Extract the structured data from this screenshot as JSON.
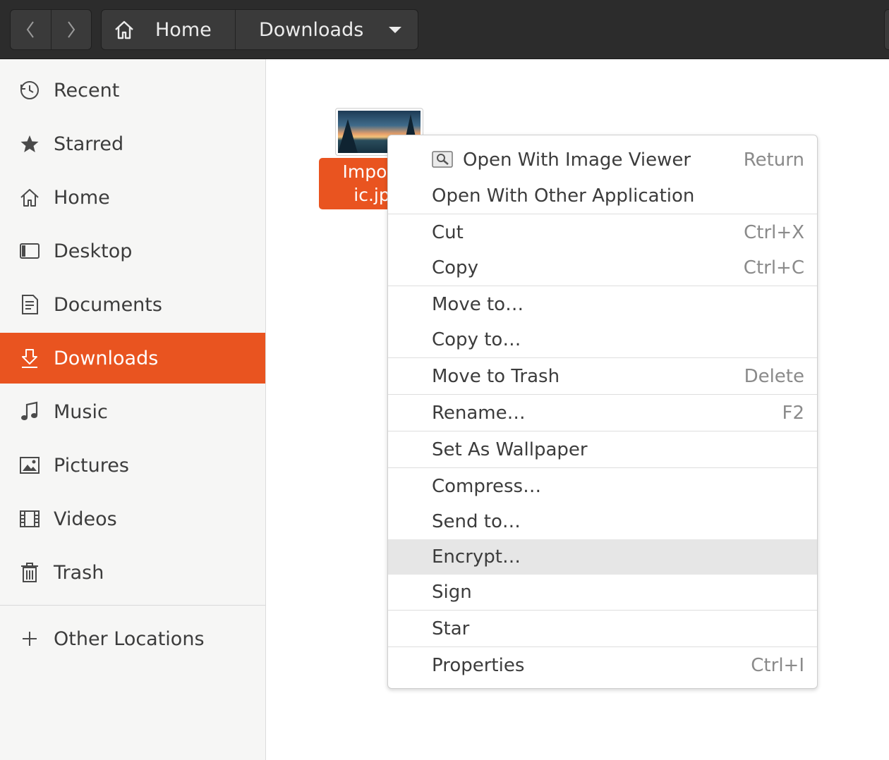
{
  "header": {
    "path": [
      {
        "label": "Home",
        "icon": "home-icon"
      },
      {
        "label": "Downloads",
        "icon": "chevron-down-icon"
      }
    ]
  },
  "sidebar": {
    "items": [
      {
        "label": "Recent",
        "icon": "clock-icon"
      },
      {
        "label": "Starred",
        "icon": "star-icon"
      },
      {
        "label": "Home",
        "icon": "home-icon"
      },
      {
        "label": "Desktop",
        "icon": "desktop-icon"
      },
      {
        "label": "Documents",
        "icon": "document-icon"
      },
      {
        "label": "Downloads",
        "icon": "download-icon",
        "active": true
      },
      {
        "label": "Music",
        "icon": "music-note-icon"
      },
      {
        "label": "Pictures",
        "icon": "picture-icon"
      },
      {
        "label": "Videos",
        "icon": "film-icon"
      },
      {
        "label": "Trash",
        "icon": "trash-icon"
      }
    ],
    "other_locations": {
      "label": "Other Locations",
      "icon": "plus-icon"
    }
  },
  "file": {
    "name_line1": "Import",
    "name_line2": "ic.jp"
  },
  "context_menu": {
    "items": [
      {
        "label": "Open With Image Viewer",
        "accel": "Return",
        "icon": "image-viewer-icon"
      },
      {
        "label": "Open With Other Application",
        "accel": ""
      },
      {
        "label": "Cut",
        "accel": "Ctrl+X"
      },
      {
        "label": "Copy",
        "accel": "Ctrl+C"
      },
      {
        "label": "Move to…",
        "accel": ""
      },
      {
        "label": "Copy to…",
        "accel": ""
      },
      {
        "label": "Move to Trash",
        "accel": "Delete"
      },
      {
        "label": "Rename…",
        "accel": "F2"
      },
      {
        "label": "Set As Wallpaper",
        "accel": ""
      },
      {
        "label": "Compress…",
        "accel": ""
      },
      {
        "label": "Send to…",
        "accel": ""
      },
      {
        "label": "Encrypt…",
        "accel": "",
        "hovered": true
      },
      {
        "label": "Sign",
        "accel": ""
      },
      {
        "label": "Star",
        "accel": ""
      },
      {
        "label": "Properties",
        "accel": "Ctrl+I"
      }
    ]
  },
  "colors": {
    "accent": "#e95420",
    "headerbar": "#2c2c2c",
    "sidebar_bg": "#f6f6f5",
    "menu_hover": "#e6e6e6"
  }
}
